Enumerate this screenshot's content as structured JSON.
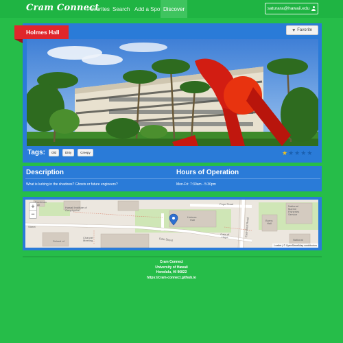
{
  "nav": {
    "brand": "Cram Connect",
    "links": [
      "Favorites",
      "Search",
      "Add a Spot",
      "Discover"
    ],
    "active": "Discover",
    "user_email": "saturara@hawaii.edu"
  },
  "spot": {
    "name": "Holmes Hall",
    "favorite_label": "Favorite",
    "tags_label": "Tags:",
    "tags": [
      "Old",
      "Dirty",
      "Creepy"
    ],
    "rating": 1,
    "rating_max": 5
  },
  "details": {
    "description_heading": "Description",
    "description_text": "What is lurking in the shadows? Ghosts or future engineers?",
    "hours_heading": "Hours of Operation",
    "hours_text": "Mon-Fri: 7:30am - 5:30pm"
  },
  "map": {
    "labels": [
      "Bachman Hall",
      "Hawaii Institute of Geophysics",
      "Holmes Hall",
      "Dole Street",
      "Pope Road",
      "East-West Road",
      "Burns Hall",
      "National Marine Fisheries Service",
      "Gate of Hope",
      "Channel Meeting",
      "Street",
      "School of",
      "National"
    ],
    "attribution": "Leaflet | © OpenStreetMap contributors",
    "zoom_in": "+",
    "zoom_out": "−"
  },
  "footer": {
    "line1": "Cram Connect",
    "line2": "University of Hawaii",
    "line3": "Honolulu, HI 96822",
    "line4": "https://cram-connect.github.io"
  },
  "colors": {
    "background": "#26bd49",
    "card": "#2a7bd8",
    "banner": "#e0262b",
    "star": "#f2c21b"
  }
}
